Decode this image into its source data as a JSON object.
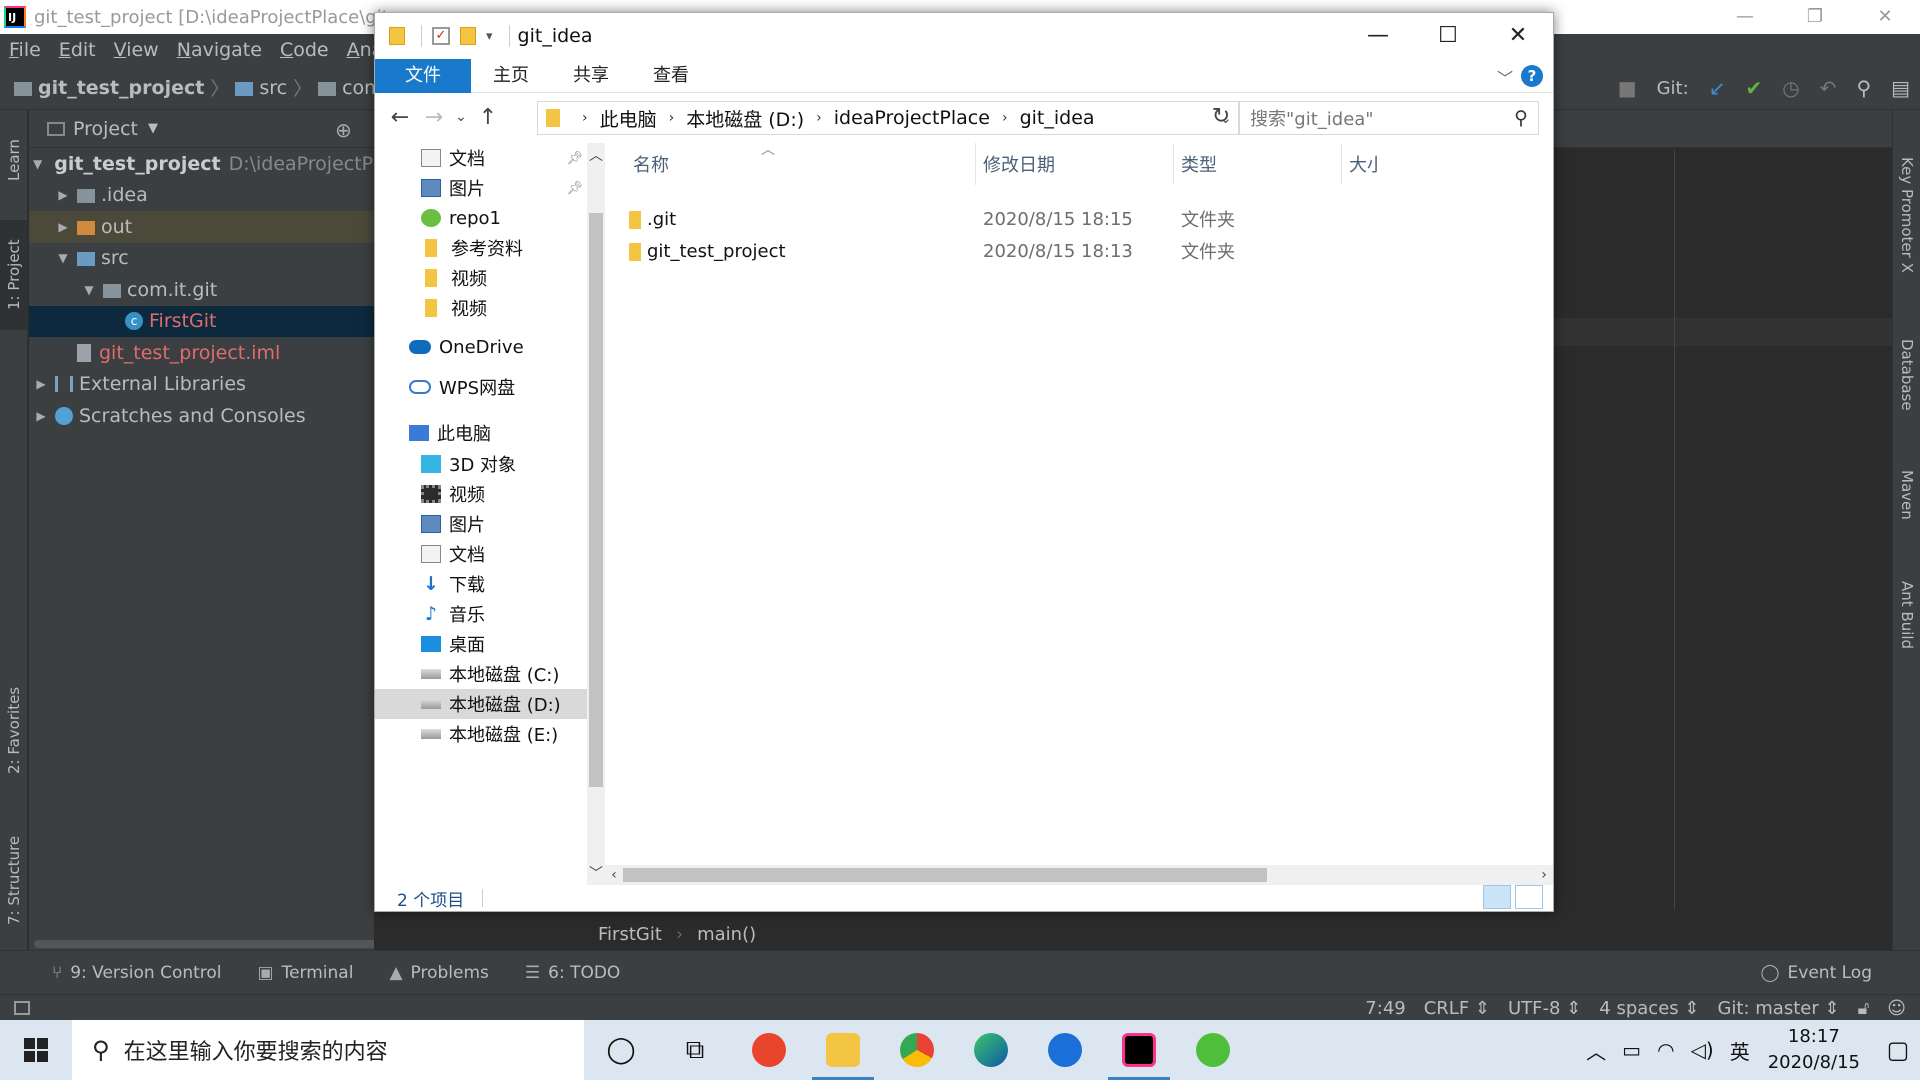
{
  "ide": {
    "window_title": "git_test_project [D:\\ideaProjectPlace\\git",
    "menu": [
      "File",
      "Edit",
      "View",
      "Navigate",
      "Code",
      "Analy"
    ],
    "breadcrumbs": [
      "git_test_project",
      "src",
      "com"
    ],
    "toolbar_git_label": "Git:",
    "project_panel_title": "Project",
    "tree": [
      {
        "label": "git_test_project",
        "path": "D:\\ideaProjectPl",
        "level": 0,
        "expanded": true
      },
      {
        "label": ".idea",
        "level": 1,
        "expanded": false
      },
      {
        "label": "out",
        "level": 1,
        "expanded": false
      },
      {
        "label": "src",
        "level": 1,
        "expanded": true
      },
      {
        "label": "com.it.git",
        "level": 2,
        "expanded": true
      },
      {
        "label": "FirstGit",
        "level": 3
      },
      {
        "label": "git_test_project.iml",
        "level": 1
      },
      {
        "label": "External Libraries",
        "level": 0,
        "expanded": false
      },
      {
        "label": "Scratches and Consoles",
        "level": 0,
        "expanded": false
      }
    ],
    "left_stripe": {
      "learn": "Learn",
      "project": "1: Project",
      "favorites": "2: Favorites",
      "structure": "7: Structure"
    },
    "right_stripe": {
      "key_promoter": "Key Promoter X",
      "database": "Database",
      "maven": "Maven",
      "ant": "Ant Build"
    },
    "editor_breadcrumb": [
      "FirstGit",
      "main()"
    ],
    "tool_tabs": {
      "version_control": "9: Version Control",
      "terminal": "Terminal",
      "problems": "Problems",
      "todo": "6: TODO",
      "event_log": "Event Log"
    },
    "status": {
      "position": "7:49",
      "line_sep": "CRLF",
      "encoding": "UTF-8",
      "indent": "4 spaces",
      "branch": "Git: master"
    }
  },
  "explorer": {
    "title": "git_idea",
    "ribbon_tabs": [
      "文件",
      "主页",
      "共享",
      "查看"
    ],
    "address": [
      "此电脑",
      "本地磁盘 (D:)",
      "ideaProjectPlace",
      "git_idea"
    ],
    "search_placeholder": "搜索\"git_idea\"",
    "nav_items": [
      {
        "label": "文档",
        "icon": "document-icon",
        "pinned": true
      },
      {
        "label": "图片",
        "icon": "pictures-icon",
        "pinned": true
      },
      {
        "label": "repo1",
        "icon": "repo-icon"
      },
      {
        "label": "参考资料",
        "icon": "folder-icon"
      },
      {
        "label": "视频",
        "icon": "folder-icon"
      },
      {
        "label": "视频",
        "icon": "folder-icon"
      },
      {
        "label": "OneDrive",
        "icon": "onedrive-icon",
        "top": true
      },
      {
        "label": "WPS网盘",
        "icon": "wps-cloud-icon",
        "top": true
      },
      {
        "label": "此电脑",
        "icon": "this-pc-icon",
        "top": true
      },
      {
        "label": "3D 对象",
        "icon": "3d-objects-icon"
      },
      {
        "label": "视频",
        "icon": "videos-icon"
      },
      {
        "label": "图片",
        "icon": "pictures-icon"
      },
      {
        "label": "文档",
        "icon": "document-icon"
      },
      {
        "label": "下载",
        "icon": "downloads-icon"
      },
      {
        "label": "音乐",
        "icon": "music-icon"
      },
      {
        "label": "桌面",
        "icon": "desktop-icon"
      },
      {
        "label": "本地磁盘 (C:)",
        "icon": "drive-icon"
      },
      {
        "label": "本地磁盘 (D:)",
        "icon": "drive-icon",
        "selected": true
      },
      {
        "label": "本地磁盘 (E:)",
        "icon": "drive-icon"
      }
    ],
    "columns": {
      "name": "名称",
      "modified": "修改日期",
      "type": "类型",
      "size": "大小"
    },
    "files": [
      {
        "name": ".git",
        "modified": "2020/8/15 18:15",
        "type": "文件夹"
      },
      {
        "name": "git_test_project",
        "modified": "2020/8/15 18:13",
        "type": "文件夹"
      }
    ],
    "item_count": "2 个项目"
  },
  "taskbar": {
    "search_placeholder": "在这里输入你要搜索的内容",
    "ime": "英",
    "time": "18:17",
    "date": "2020/8/15"
  }
}
